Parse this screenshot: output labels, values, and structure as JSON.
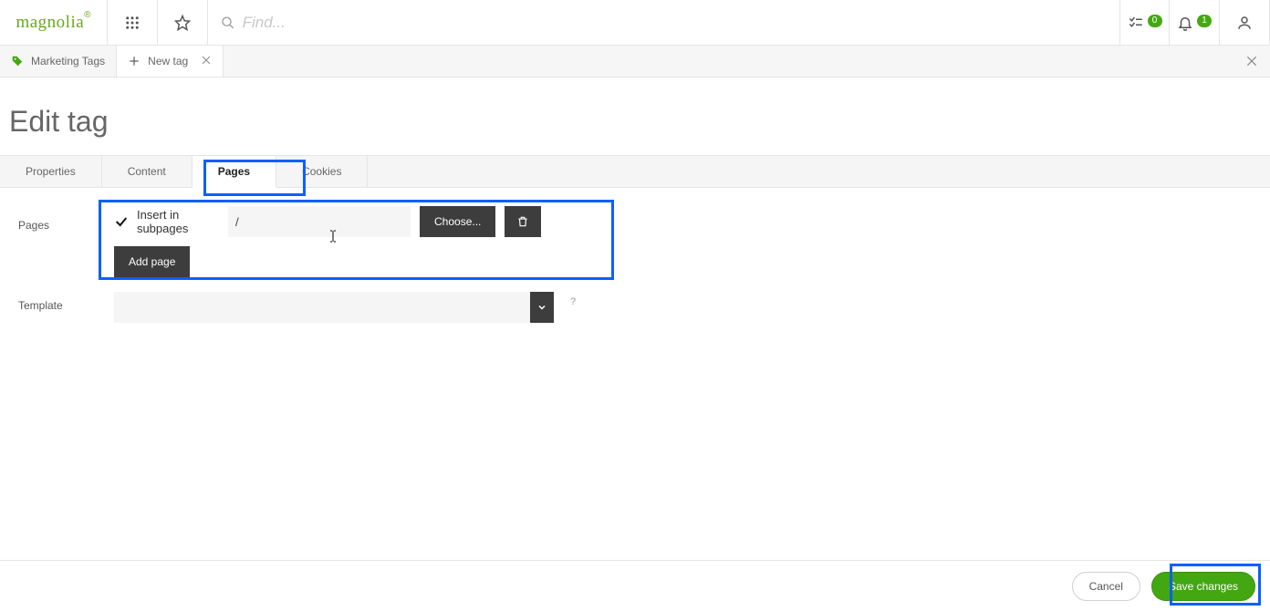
{
  "header": {
    "logo": "magnolia",
    "search_placeholder": "Find...",
    "tasks_badge": "0",
    "notifications_badge": "1"
  },
  "app_tabs": {
    "tab1_label": "Marketing Tags",
    "tab2_label": "New tag"
  },
  "page": {
    "title": "Edit tag"
  },
  "form_tabs": {
    "t1": "Properties",
    "t2": "Content",
    "t3": "Pages",
    "t4": "Cookies"
  },
  "form": {
    "pages_label": "Pages",
    "insert_in_subpages": "Insert in subpages",
    "path_value": "/",
    "choose_label": "Choose...",
    "add_page_label": "Add page",
    "template_label": "Template",
    "template_help": "?"
  },
  "footer": {
    "cancel": "Cancel",
    "save": "Save changes"
  }
}
